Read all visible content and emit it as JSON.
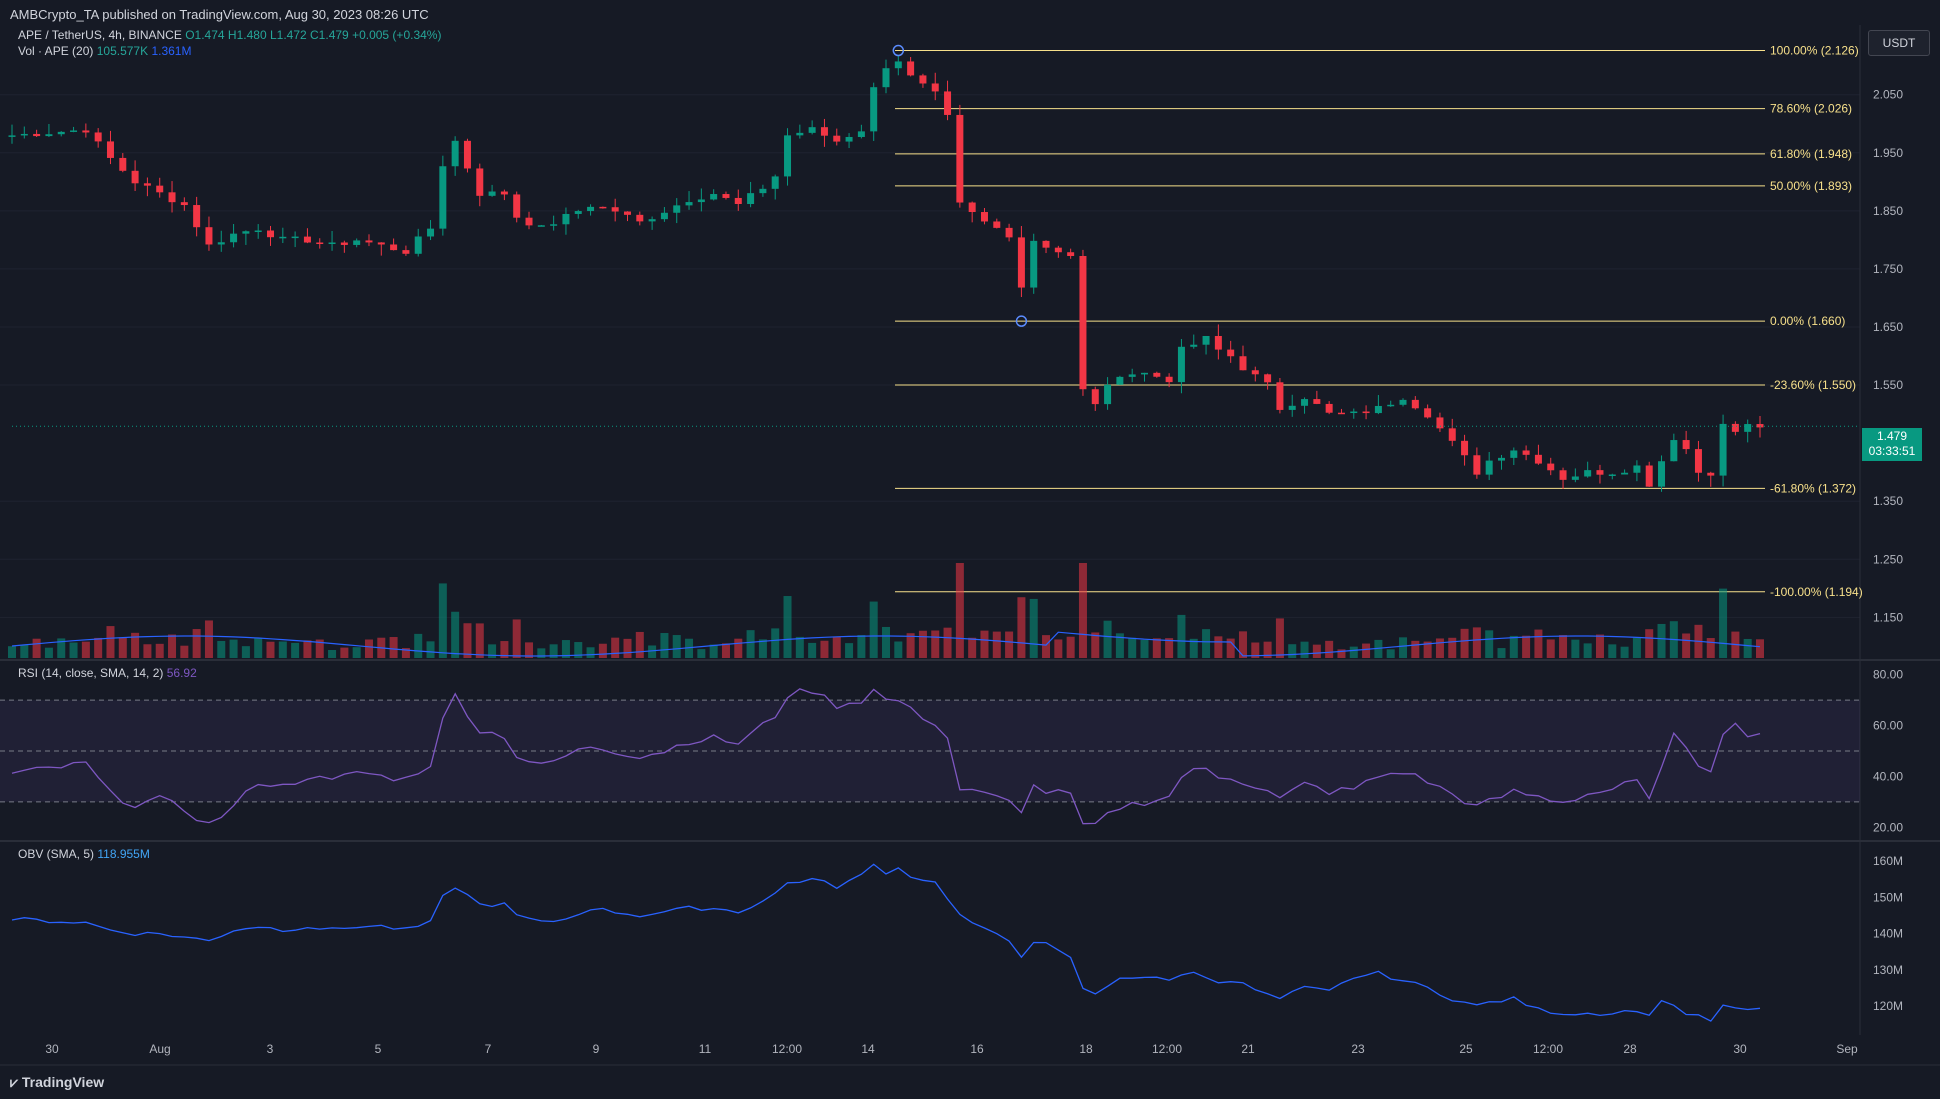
{
  "published": "AMBCrypto_TA published on TradingView.com, Aug 30, 2023 08:26 UTC",
  "symbol_line": {
    "symbol": "APE / TetherUS, 4h, BINANCE",
    "o": "O1.474",
    "h": "H1.480",
    "l": "L1.472",
    "c": "C1.479",
    "change": "+0.005 (+0.34%)"
  },
  "vol_line": {
    "label": "Vol · APE (20)",
    "v1": "105.577K",
    "v2": "1.361M"
  },
  "rsi_line": {
    "label": "RSI (14, close, SMA, 14, 2)",
    "value": "56.92"
  },
  "obv_line": {
    "label": "OBV (SMA, 5)",
    "value": "118.955M"
  },
  "quote_unit": "USDT",
  "last_price": {
    "price": "1.479",
    "countdown": "03:33:51"
  },
  "brand": "TradingView",
  "colors": {
    "up": "#089981",
    "down": "#f23645",
    "fib": "#f7e08b",
    "rsi": "#7e57c2",
    "obv": "#2962ff",
    "vol_ma": "#2962ff",
    "bg": "#161a25"
  },
  "chart_data": [
    {
      "type": "candlestick",
      "title": "APE / TetherUS, 4h, BINANCE",
      "ylim": [
        1.08,
        2.17
      ],
      "price_axis_ticks": [
        "2.050",
        "1.950",
        "1.850",
        "1.750",
        "1.650",
        "1.550",
        "1.350",
        "1.250",
        "1.150"
      ],
      "price_axis_values": [
        2.05,
        1.95,
        1.85,
        1.75,
        1.65,
        1.55,
        1.35,
        1.25,
        1.15
      ],
      "x_ticks": [
        "30",
        "Aug",
        "3",
        "5",
        "7",
        "9",
        "11",
        "12:00",
        "14",
        "16",
        "18",
        "12:00",
        "21",
        "23",
        "25",
        "12:00",
        "28",
        "30",
        "Sep"
      ],
      "close_path": [
        [
          0,
          1.98
        ],
        [
          6,
          1.99
        ],
        [
          8,
          1.94
        ],
        [
          10,
          1.9
        ],
        [
          12,
          1.88
        ],
        [
          14,
          1.86
        ],
        [
          16,
          1.79
        ],
        [
          18,
          1.81
        ],
        [
          20,
          1.82
        ],
        [
          22,
          1.8
        ],
        [
          24,
          1.8
        ],
        [
          26,
          1.79
        ],
        [
          28,
          1.8
        ],
        [
          30,
          1.79
        ],
        [
          32,
          1.78
        ],
        [
          34,
          1.82
        ],
        [
          35,
          1.93
        ],
        [
          36,
          1.97
        ],
        [
          38,
          1.88
        ],
        [
          40,
          1.88
        ],
        [
          41,
          1.84
        ],
        [
          43,
          1.82
        ],
        [
          45,
          1.84
        ],
        [
          47,
          1.86
        ],
        [
          49,
          1.85
        ],
        [
          51,
          1.83
        ],
        [
          53,
          1.85
        ],
        [
          55,
          1.87
        ],
        [
          57,
          1.88
        ],
        [
          59,
          1.86
        ],
        [
          61,
          1.89
        ],
        [
          62,
          1.91
        ],
        [
          63,
          1.98
        ],
        [
          65,
          1.99
        ],
        [
          67,
          1.97
        ],
        [
          69,
          1.99
        ],
        [
          70,
          2.06
        ],
        [
          71,
          2.1
        ],
        [
          72,
          2.11
        ],
        [
          73,
          2.08
        ],
        [
          75,
          2.05
        ],
        [
          76,
          2.01
        ],
        [
          77,
          1.86
        ],
        [
          79,
          1.83
        ],
        [
          81,
          1.81
        ],
        [
          82,
          1.72
        ],
        [
          83,
          1.8
        ],
        [
          84,
          1.79
        ],
        [
          86,
          1.77
        ],
        [
          87,
          1.54
        ],
        [
          88,
          1.52
        ],
        [
          90,
          1.57
        ],
        [
          92,
          1.57
        ],
        [
          94,
          1.56
        ],
        [
          95,
          1.61
        ],
        [
          96,
          1.62
        ],
        [
          97,
          1.63
        ],
        [
          98,
          1.61
        ],
        [
          99,
          1.6
        ],
        [
          100,
          1.58
        ],
        [
          102,
          1.55
        ],
        [
          103,
          1.51
        ],
        [
          105,
          1.53
        ],
        [
          107,
          1.5
        ],
        [
          109,
          1.5
        ],
        [
          111,
          1.51
        ],
        [
          113,
          1.53
        ],
        [
          115,
          1.5
        ],
        [
          117,
          1.45
        ],
        [
          119,
          1.4
        ],
        [
          120,
          1.42
        ],
        [
          122,
          1.44
        ],
        [
          124,
          1.42
        ],
        [
          126,
          1.39
        ],
        [
          128,
          1.4
        ],
        [
          130,
          1.4
        ],
        [
          132,
          1.41
        ],
        [
          133,
          1.38
        ],
        [
          134,
          1.42
        ],
        [
          135,
          1.46
        ],
        [
          136,
          1.44
        ],
        [
          137,
          1.4
        ],
        [
          138,
          1.4
        ],
        [
          139,
          1.48
        ],
        [
          140,
          1.47
        ],
        [
          141,
          1.48
        ],
        [
          142,
          1.479
        ]
      ],
      "fibonacci": [
        {
          "label": "100.00% (2.126)",
          "level": 2.126
        },
        {
          "label": "78.60% (2.026)",
          "level": 2.026
        },
        {
          "label": "61.80% (1.948)",
          "level": 1.948
        },
        {
          "label": "50.00% (1.893)",
          "level": 1.893
        },
        {
          "label": "0.00% (1.660)",
          "level": 1.66
        },
        {
          "label": "-23.60% (1.550)",
          "level": 1.55
        },
        {
          "label": "-61.80% (1.372)",
          "level": 1.372
        },
        {
          "label": "-100.00% (1.194)",
          "level": 1.194
        }
      ],
      "last_price": 1.479
    },
    {
      "type": "line",
      "title": "RSI (14, close, SMA, 14, 2)",
      "ylim": [
        15,
        85
      ],
      "ticks": [
        "80.00",
        "60.00",
        "40.00",
        "20.00"
      ],
      "tick_values": [
        80,
        60,
        40,
        20
      ],
      "bands": [
        70,
        50,
        30
      ],
      "values": [
        [
          0,
          41
        ],
        [
          6,
          45
        ],
        [
          8,
          33
        ],
        [
          10,
          29
        ],
        [
          12,
          31
        ],
        [
          14,
          27
        ],
        [
          16,
          21
        ],
        [
          18,
          28
        ],
        [
          20,
          38
        ],
        [
          22,
          36
        ],
        [
          24,
          40
        ],
        [
          26,
          38
        ],
        [
          28,
          42
        ],
        [
          30,
          40
        ],
        [
          32,
          39
        ],
        [
          34,
          45
        ],
        [
          35,
          62
        ],
        [
          36,
          72
        ],
        [
          38,
          58
        ],
        [
          40,
          56
        ],
        [
          41,
          48
        ],
        [
          43,
          44
        ],
        [
          45,
          48
        ],
        [
          47,
          52
        ],
        [
          49,
          50
        ],
        [
          51,
          48
        ],
        [
          53,
          50
        ],
        [
          55,
          54
        ],
        [
          57,
          55
        ],
        [
          59,
          53
        ],
        [
          61,
          60
        ],
        [
          62,
          64
        ],
        [
          63,
          72
        ],
        [
          65,
          74
        ],
        [
          67,
          68
        ],
        [
          69,
          70
        ],
        [
          70,
          74
        ],
        [
          71,
          70
        ],
        [
          72,
          70
        ],
        [
          73,
          66
        ],
        [
          75,
          61
        ],
        [
          76,
          55
        ],
        [
          77,
          35
        ],
        [
          79,
          33
        ],
        [
          81,
          30
        ],
        [
          82,
          27
        ],
        [
          83,
          36
        ],
        [
          84,
          34
        ],
        [
          86,
          33
        ],
        [
          87,
          20
        ],
        [
          88,
          21
        ],
        [
          90,
          28
        ],
        [
          92,
          30
        ],
        [
          94,
          32
        ],
        [
          95,
          40
        ],
        [
          96,
          42
        ],
        [
          97,
          43
        ],
        [
          98,
          40
        ],
        [
          99,
          40
        ],
        [
          100,
          38
        ],
        [
          102,
          34
        ],
        [
          103,
          31
        ],
        [
          105,
          37
        ],
        [
          107,
          34
        ],
        [
          109,
          35
        ],
        [
          111,
          40
        ],
        [
          113,
          42
        ],
        [
          115,
          38
        ],
        [
          117,
          33
        ],
        [
          119,
          28
        ],
        [
          120,
          30
        ],
        [
          122,
          34
        ],
        [
          124,
          32
        ],
        [
          126,
          30
        ],
        [
          128,
          33
        ],
        [
          130,
          35
        ],
        [
          132,
          38
        ],
        [
          133,
          30
        ],
        [
          134,
          45
        ],
        [
          135,
          56
        ],
        [
          136,
          50
        ],
        [
          137,
          45
        ],
        [
          138,
          43
        ],
        [
          139,
          58
        ],
        [
          140,
          60
        ],
        [
          141,
          57
        ],
        [
          142,
          56.92
        ]
      ]
    },
    {
      "type": "line",
      "title": "OBV (SMA, 5)",
      "ylim": [
        112,
        165
      ],
      "ticks": [
        "160M",
        "150M",
        "140M",
        "130M",
        "120M"
      ],
      "tick_values": [
        160,
        150,
        140,
        130,
        120
      ],
      "values": [
        [
          0,
          144
        ],
        [
          6,
          143
        ],
        [
          8,
          141
        ],
        [
          10,
          140
        ],
        [
          12,
          140
        ],
        [
          14,
          139
        ],
        [
          16,
          138
        ],
        [
          18,
          141
        ],
        [
          20,
          142
        ],
        [
          22,
          141
        ],
        [
          24,
          142
        ],
        [
          26,
          141
        ],
        [
          28,
          142
        ],
        [
          30,
          142
        ],
        [
          32,
          141
        ],
        [
          34,
          143
        ],
        [
          35,
          150
        ],
        [
          36,
          153
        ],
        [
          38,
          148
        ],
        [
          40,
          148
        ],
        [
          41,
          145
        ],
        [
          43,
          143
        ],
        [
          45,
          144
        ],
        [
          47,
          147
        ],
        [
          49,
          146
        ],
        [
          51,
          145
        ],
        [
          53,
          146
        ],
        [
          55,
          147
        ],
        [
          57,
          147
        ],
        [
          59,
          146
        ],
        [
          61,
          149
        ],
        [
          62,
          151
        ],
        [
          63,
          154
        ],
        [
          65,
          155
        ],
        [
          67,
          153
        ],
        [
          69,
          156
        ],
        [
          70,
          159
        ],
        [
          71,
          157
        ],
        [
          72,
          158
        ],
        [
          73,
          156
        ],
        [
          75,
          154
        ],
        [
          76,
          150
        ],
        [
          77,
          145
        ],
        [
          79,
          141
        ],
        [
          81,
          138
        ],
        [
          82,
          134
        ],
        [
          83,
          138
        ],
        [
          84,
          137
        ],
        [
          86,
          133
        ],
        [
          87,
          125
        ],
        [
          88,
          123
        ],
        [
          90,
          128
        ],
        [
          92,
          128
        ],
        [
          94,
          127
        ],
        [
          95,
          129
        ],
        [
          96,
          129
        ],
        [
          97,
          128
        ],
        [
          98,
          127
        ],
        [
          99,
          127
        ],
        [
          100,
          126
        ],
        [
          102,
          123
        ],
        [
          103,
          122
        ],
        [
          105,
          125
        ],
        [
          107,
          124
        ],
        [
          109,
          128
        ],
        [
          111,
          129
        ],
        [
          113,
          127
        ],
        [
          115,
          125
        ],
        [
          117,
          122
        ],
        [
          119,
          120
        ],
        [
          120,
          121
        ],
        [
          122,
          122
        ],
        [
          124,
          119
        ],
        [
          126,
          118
        ],
        [
          128,
          118
        ],
        [
          130,
          118
        ],
        [
          132,
          119
        ],
        [
          133,
          117
        ],
        [
          134,
          122
        ],
        [
          135,
          120
        ],
        [
          136,
          118
        ],
        [
          137,
          117
        ],
        [
          138,
          116
        ],
        [
          139,
          120
        ],
        [
          140,
          119
        ],
        [
          141,
          119
        ],
        [
          142,
          118.955
        ]
      ]
    }
  ]
}
